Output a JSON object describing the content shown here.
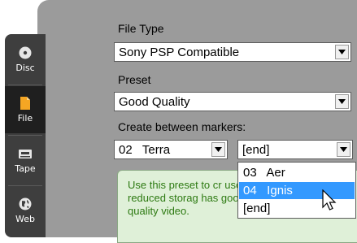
{
  "sidebar": {
    "items": [
      {
        "label": "Disc",
        "icon": "disc-icon",
        "active": false
      },
      {
        "label": "File",
        "icon": "file-icon",
        "active": true
      },
      {
        "label": "Tape",
        "icon": "tape-icon",
        "active": false
      },
      {
        "label": "Web",
        "icon": "globe-icon",
        "active": false
      }
    ]
  },
  "file_type": {
    "label": "File Type",
    "value": "Sony PSP Compatible"
  },
  "preset": {
    "label": "Preset",
    "value": "Good Quality"
  },
  "markers": {
    "label": "Create between markers:",
    "start_value": "02   Terra",
    "end_value": "[end]"
  },
  "dropdown": {
    "options": [
      "03   Aer",
      "04   Ignis",
      "[end]"
    ],
    "highlighted_index": 1
  },
  "info": {
    "text": "Use this preset to cr uses reduced storag has good quality video."
  },
  "colors": {
    "panel": "#9b9b9b",
    "sidebar": "#3e3e3e",
    "highlight": "#3399ff",
    "info_bg": "#dff0d8",
    "info_text": "#2d7a12",
    "file_icon": "#f5a623"
  }
}
